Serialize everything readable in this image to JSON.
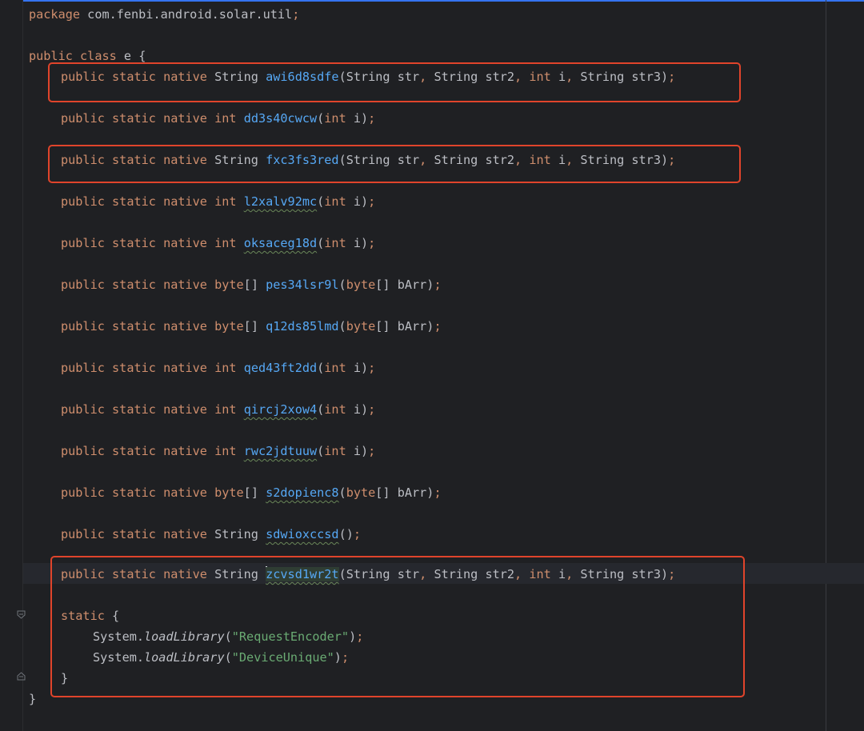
{
  "code": {
    "package_line": {
      "keyword": "package",
      "name": "com.fenbi.android.solar.util",
      "end": ";"
    },
    "class_line": {
      "kw1": "public",
      "kw2": "class",
      "name": "e",
      "brace": "{"
    },
    "method_prefix": {
      "public": "public",
      "static": "static",
      "native": "native"
    },
    "methods": [
      {
        "ret": "String",
        "name": "awi6d8sdfe",
        "params": "(String str, String str2, int i, String str3);"
      },
      {
        "ret": "int",
        "name": "dd3s40cwcw",
        "params": "(int i);"
      },
      {
        "ret": "String",
        "name": "fxc3fs3red",
        "params": "(String str, String str2, int i, String str3);"
      },
      {
        "ret": "int",
        "name": "l2xalv92mc",
        "params": "(int i);"
      },
      {
        "ret": "int",
        "name": "oksaceg18d",
        "params": "(int i);"
      },
      {
        "ret": "byte",
        "name": "pes34lsr9l",
        "params": "(byte[] bArr);"
      },
      {
        "ret": "byte",
        "name": "q12ds85lmd",
        "params": "(byte[] bArr);"
      },
      {
        "ret": "int",
        "name": "qed43ft2dd",
        "params": "(int i);"
      },
      {
        "ret": "int",
        "name": "qircj2xow4",
        "params": "(int i);"
      },
      {
        "ret": "int",
        "name": "rwc2jdtuuw",
        "params": "(int i);"
      },
      {
        "ret": "byte",
        "name": "s2dopienc8",
        "params": "(byte[] bArr);"
      },
      {
        "ret": "String",
        "name": "sdwioxccsd",
        "params": "();"
      },
      {
        "ret": "String",
        "name": "zcvsd1wr2t",
        "params": "(String str, String str2, int i, String str3);"
      }
    ],
    "static_block": {
      "keyword": "static",
      "open": "{",
      "calls": [
        {
          "obj": "System.",
          "method": "loadLibrary",
          "arg": "\"RequestEncoder\"",
          "end": ");"
        },
        {
          "obj": "System.",
          "method": "loadLibrary",
          "arg": "\"DeviceUnique\"",
          "end": ");"
        }
      ],
      "close": "}"
    },
    "class_close": "}"
  },
  "colors": {
    "background": "#1f2023",
    "keyword": "#cf8e6d",
    "method_name": "#56a8f5",
    "string": "#6aab73",
    "default_text": "#bcbec4",
    "annotation_box": "#e0442b"
  }
}
